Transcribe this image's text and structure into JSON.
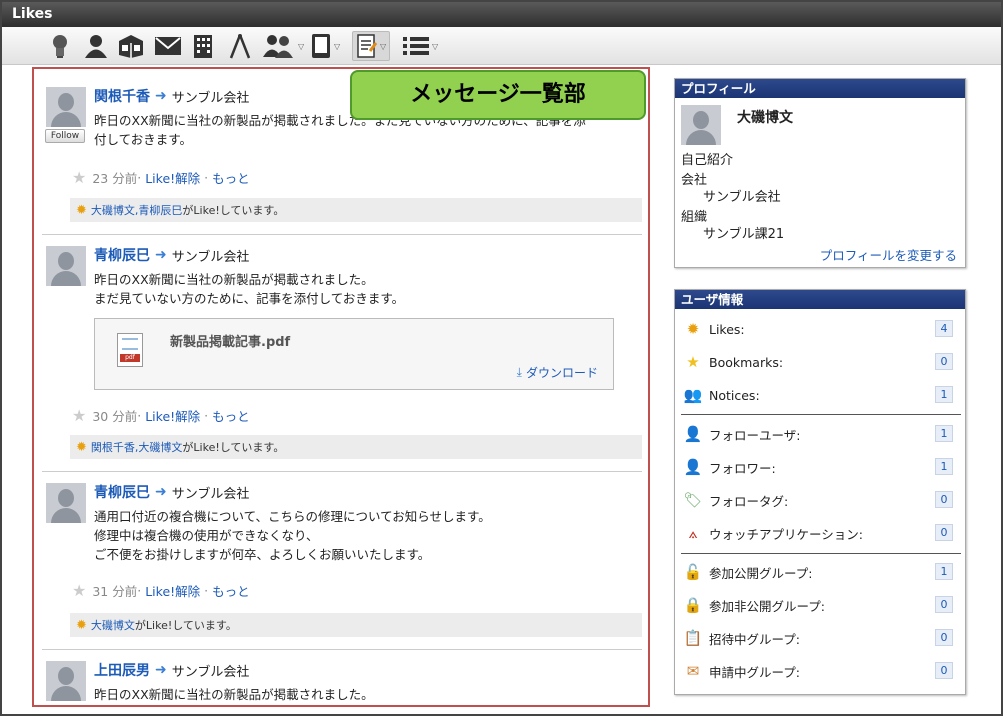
{
  "window": {
    "title": "Likes"
  },
  "toolbar": {
    "icons": [
      "bulb-icon",
      "user-icon",
      "box-icon",
      "mail-icon",
      "building-icon",
      "compass-icon",
      "group-icon",
      "tablet-icon",
      "memo-icon",
      "list-icon"
    ]
  },
  "feed": {
    "callout": "メッセージ一覧部",
    "follow_label": "Follow",
    "posts": [
      {
        "author": "関根千香",
        "target": "サンブル会社",
        "text": "昨日のXX新聞に当社の新製品が掲載されました。まだ見ていない方のために、記事を添\n付しておきます。",
        "time": "23 分前",
        "unlike": "Like!解除",
        "more": "もっと",
        "likers": "大磯博文,青柳辰巳",
        "liked_suffix": "がLike!しています。"
      },
      {
        "author": "青柳辰巳",
        "target": "サンブル会社",
        "text": "昨日のXX新聞に当社の新製品が掲載されました。\nまだ見ていない方のために、記事を添付しておきます。",
        "attachment": {
          "filename": "新製品掲載記事.pdf",
          "download": "ダウンロード"
        },
        "time": "30 分前",
        "unlike": "Like!解除",
        "more": "もっと",
        "likers": "関根千香,大磯博文",
        "liked_suffix": "がLike!しています。"
      },
      {
        "author": "青柳辰巳",
        "target": "サンブル会社",
        "text": "通用口付近の複合機について、こちらの修理についてお知らせします。\n修理中は複合機の使用ができなくなり、\nご不便をお掛けしますが何卒、よろしくお願いいたします。",
        "time": "31 分前",
        "unlike": "Like!解除",
        "more": "もっと",
        "likers": "大磯博文",
        "liked_suffix": "がLike!しています。"
      },
      {
        "author": "上田辰男",
        "target": "サンブル会社",
        "text": "昨日のXX新聞に当社の新製品が掲載されました。"
      }
    ]
  },
  "profile": {
    "header": "プロフィール",
    "name": "大磯博文",
    "intro_label": "自己紹介",
    "company_label": "会社",
    "company": "サンブル会社",
    "org_label": "組織",
    "org": "サンブル課21",
    "edit_link": "プロフィールを変更する"
  },
  "userinfo": {
    "header": "ユーザ情報",
    "group1": [
      {
        "label": "Likes:",
        "count": "4",
        "icon": "sun-icon"
      },
      {
        "label": "Bookmarks:",
        "count": "0",
        "icon": "star-icon"
      },
      {
        "label": "Notices:",
        "count": "1",
        "icon": "people-icon"
      }
    ],
    "group2": [
      {
        "label": "フォローユーザ:",
        "count": "1",
        "icon": "follow-user-icon"
      },
      {
        "label": "フォロワー:",
        "count": "1",
        "icon": "follower-icon"
      },
      {
        "label": "フォロータグ:",
        "count": "0",
        "icon": "tag-icon"
      },
      {
        "label": "ウォッチアプリケーション:",
        "count": "0",
        "icon": "compass-icon"
      }
    ],
    "group3": [
      {
        "label": "参加公開グループ:",
        "count": "1",
        "icon": "unlock-icon"
      },
      {
        "label": "参加非公開グループ:",
        "count": "0",
        "icon": "lock-icon"
      },
      {
        "label": "招待中グループ:",
        "count": "0",
        "icon": "invite-icon"
      },
      {
        "label": "申請中グループ:",
        "count": "0",
        "icon": "envelope-icon"
      }
    ]
  }
}
